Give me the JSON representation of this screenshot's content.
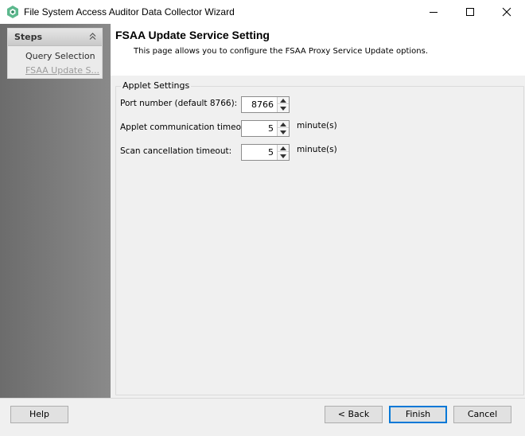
{
  "window": {
    "title": "File System Access Auditor Data Collector Wizard",
    "icon": "app-logo-icon",
    "accent": "#5cb88d"
  },
  "sidebar": {
    "header": "Steps",
    "steps": [
      {
        "label": "Query Selection",
        "state": "completed"
      },
      {
        "label": "FSAA Update S...",
        "state": "current"
      }
    ]
  },
  "page": {
    "title": "FSAA Update Service Setting",
    "description": "This page allows you to configure the FSAA Proxy Service Update options."
  },
  "settings": {
    "group_label": "Applet Settings",
    "rows": [
      {
        "label": "Port number (default 8766):",
        "value": "8766",
        "unit": ""
      },
      {
        "label": "Applet communication timeout:",
        "value": "5",
        "unit": "minute(s)"
      },
      {
        "label": "Scan cancellation timeout:",
        "value": "5",
        "unit": "minute(s)"
      }
    ]
  },
  "footer": {
    "help": "Help",
    "back": "< Back",
    "finish": "Finish",
    "cancel": "Cancel"
  }
}
